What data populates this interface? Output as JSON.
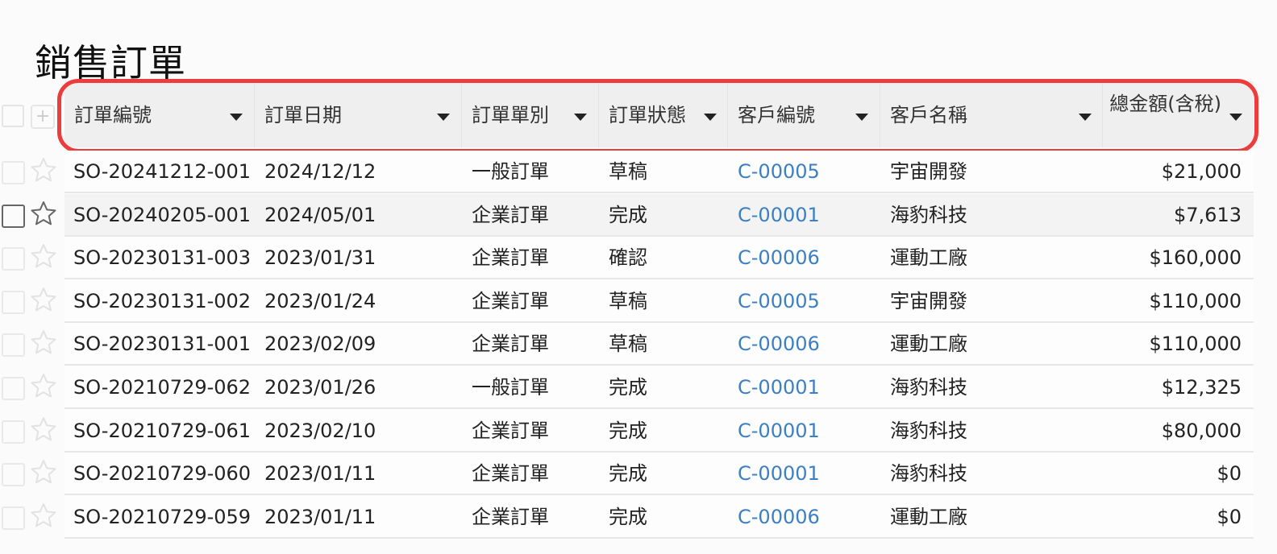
{
  "page": {
    "title": "銷售訂單"
  },
  "table": {
    "columns": [
      {
        "key": "order_no",
        "label": "訂單編號"
      },
      {
        "key": "order_date",
        "label": "訂單日期"
      },
      {
        "key": "order_type",
        "label": "訂單單別"
      },
      {
        "key": "order_status",
        "label": "訂單狀態"
      },
      {
        "key": "customer_no",
        "label": "客戶編號"
      },
      {
        "key": "customer_name",
        "label": "客戶名稱"
      },
      {
        "key": "total_amount",
        "label": "總金額(含稅)"
      }
    ],
    "add_button_label": "+",
    "rows": [
      {
        "order_no": "SO-20241212-001",
        "order_date": "2024/12/12",
        "order_type": "一般訂單",
        "order_status": "草稿",
        "customer_no": "C-00005",
        "customer_name": "宇宙開發",
        "total_amount": "$21,000"
      },
      {
        "order_no": "SO-20240205-001",
        "order_date": "2024/05/01",
        "order_type": "企業訂單",
        "order_status": "完成",
        "customer_no": "C-00001",
        "customer_name": "海豹科技",
        "total_amount": "$7,613"
      },
      {
        "order_no": "SO-20230131-003",
        "order_date": "2023/01/31",
        "order_type": "企業訂單",
        "order_status": "確認",
        "customer_no": "C-00006",
        "customer_name": "運動工廠",
        "total_amount": "$160,000"
      },
      {
        "order_no": "SO-20230131-002",
        "order_date": "2023/01/24",
        "order_type": "企業訂單",
        "order_status": "草稿",
        "customer_no": "C-00005",
        "customer_name": "宇宙開發",
        "total_amount": "$110,000"
      },
      {
        "order_no": "SO-20230131-001",
        "order_date": "2023/02/09",
        "order_type": "企業訂單",
        "order_status": "草稿",
        "customer_no": "C-00006",
        "customer_name": "運動工廠",
        "total_amount": "$110,000"
      },
      {
        "order_no": "SO-20210729-062",
        "order_date": "2023/01/26",
        "order_type": "一般訂單",
        "order_status": "完成",
        "customer_no": "C-00001",
        "customer_name": "海豹科技",
        "total_amount": "$12,325"
      },
      {
        "order_no": "SO-20210729-061",
        "order_date": "2023/02/10",
        "order_type": "企業訂單",
        "order_status": "完成",
        "customer_no": "C-00001",
        "customer_name": "海豹科技",
        "total_amount": "$80,000"
      },
      {
        "order_no": "SO-20210729-060",
        "order_date": "2023/01/11",
        "order_type": "企業訂單",
        "order_status": "完成",
        "customer_no": "C-00001",
        "customer_name": "海豹科技",
        "total_amount": "$0"
      },
      {
        "order_no": "SO-20210729-059",
        "order_date": "2023/01/11",
        "order_type": "企業訂單",
        "order_status": "完成",
        "customer_no": "C-00006",
        "customer_name": "運動工廠",
        "total_amount": "$0"
      }
    ]
  },
  "colors": {
    "link": "#3b7fc4",
    "highlight": "#ee3b3b",
    "header_bg": "#efefef"
  },
  "icons": [
    "checkbox-icon",
    "star-icon",
    "plus-icon",
    "sort-caret-icon"
  ]
}
